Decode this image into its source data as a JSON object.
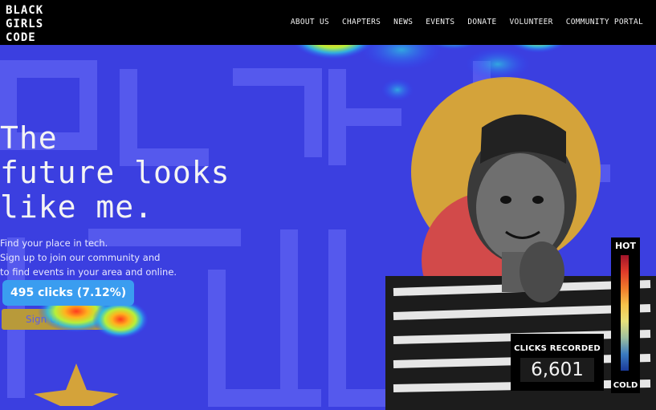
{
  "logo": {
    "lines": [
      "BLACK",
      "GIRLS",
      "CODE"
    ]
  },
  "nav": {
    "items": [
      "ABOUT US",
      "CHAPTERS",
      "NEWS",
      "EVENTS",
      "DONATE",
      "VOLUNTEER",
      "COMMUNITY PORTAL"
    ]
  },
  "hero": {
    "headline": [
      "The",
      "future looks",
      "like me."
    ],
    "subtext": [
      "Find your place in tech.",
      "Sign up to join our community and",
      "to find events in your area and online."
    ],
    "cta_label": "Sign Up"
  },
  "heatmap": {
    "tooltip": "495 clicks (7.12%)",
    "legend_hot": "HOT",
    "legend_cold": "COLD",
    "clicks_label": "CLICKS RECORDED",
    "clicks_value": "6,601"
  },
  "colors": {
    "hero_blue": "#3b3fe0",
    "mustard": "#d4a33a",
    "coral": "#d24a4a",
    "tooltip_blue": "#3a9df0"
  }
}
